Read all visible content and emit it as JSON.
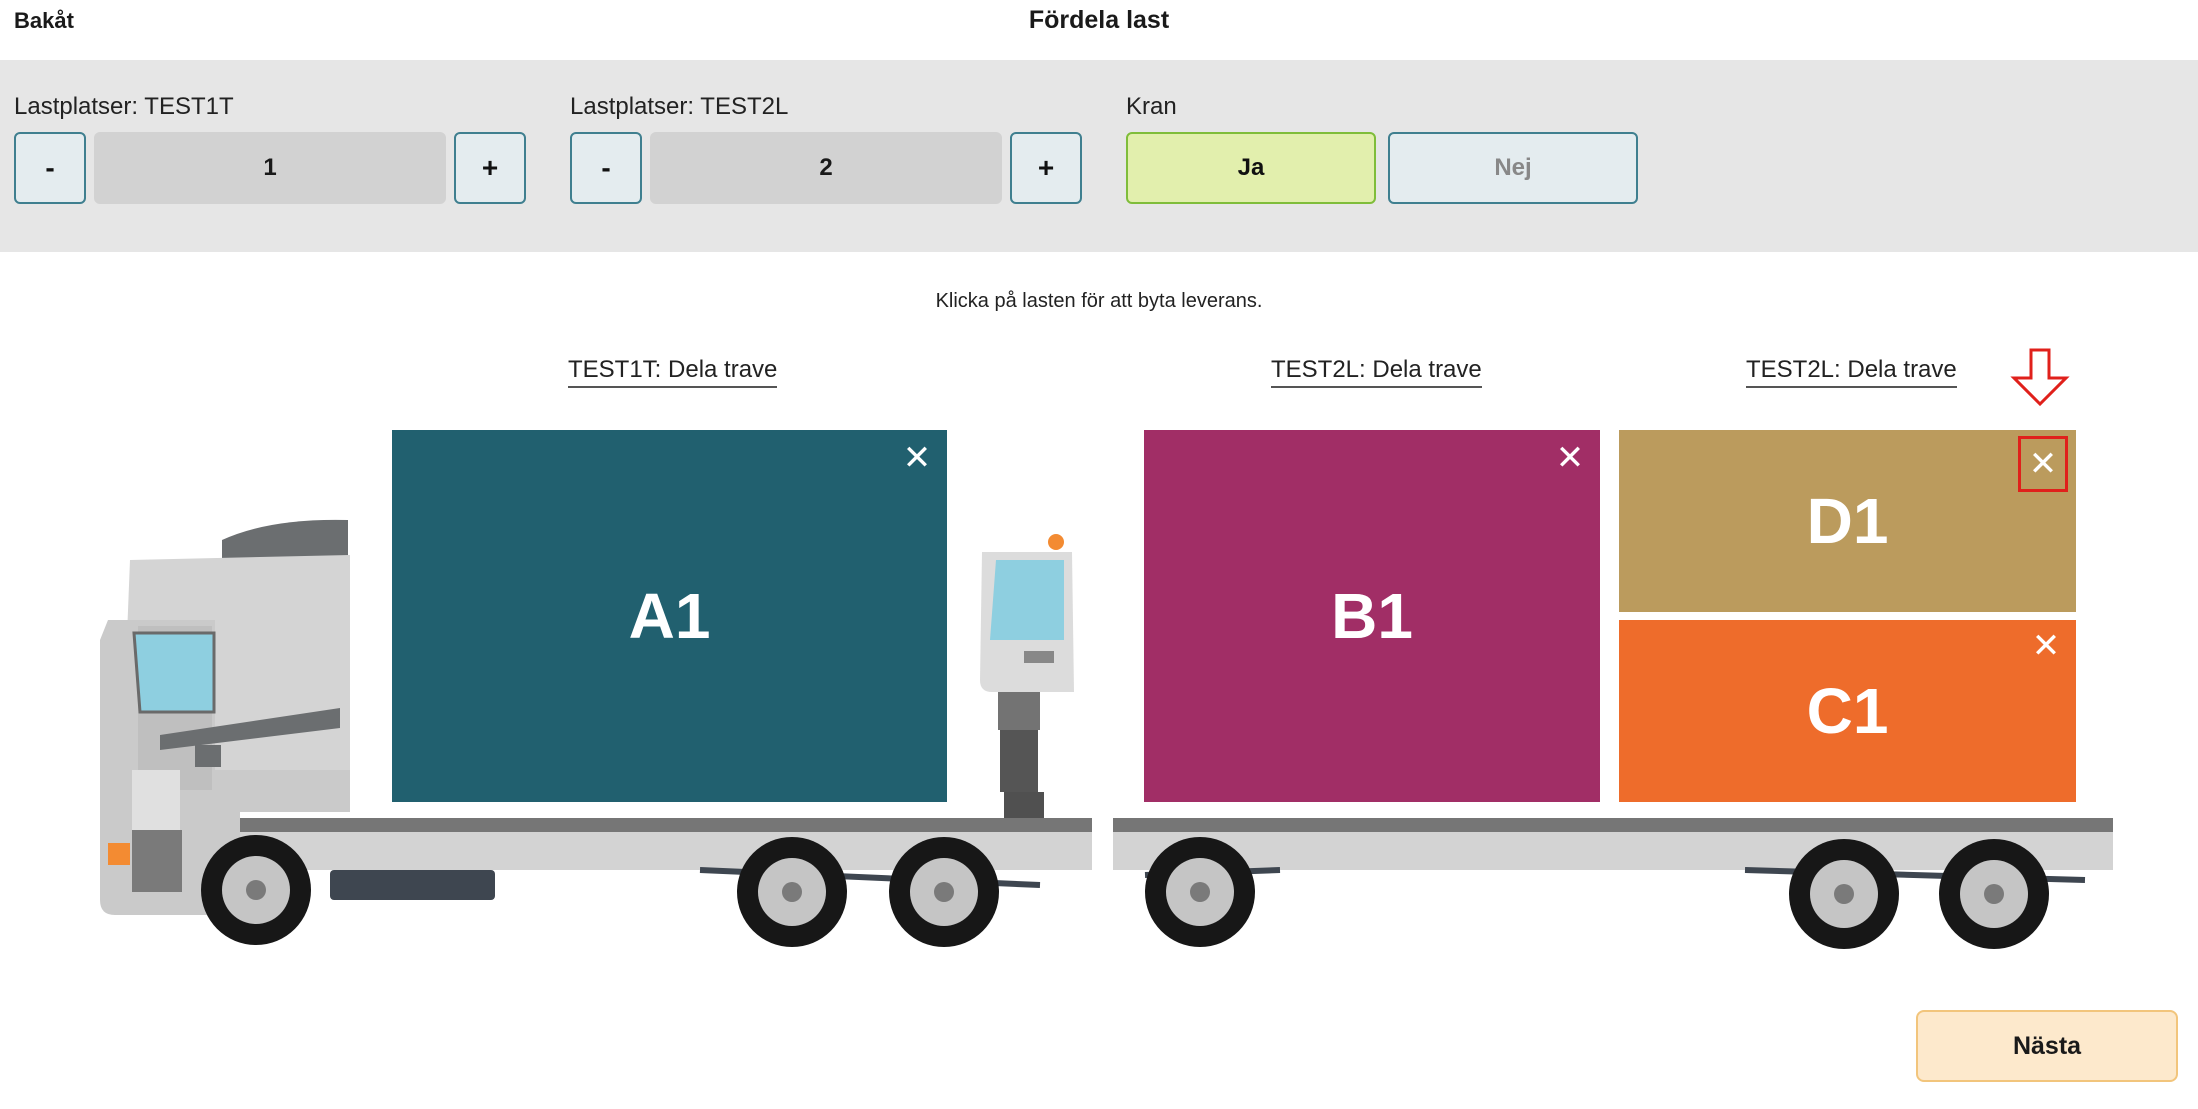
{
  "header": {
    "back_label": "Bakåt",
    "title": "Fördela last"
  },
  "controls": {
    "stop1": {
      "label": "Lastplatser: TEST1T",
      "minus": "-",
      "value": "1",
      "plus": "+"
    },
    "stop2": {
      "label": "Lastplatser: TEST2L",
      "minus": "-",
      "value": "2",
      "plus": "+"
    },
    "crane": {
      "label": "Kran",
      "yes": "Ja",
      "no": "Nej",
      "selected": "Ja"
    }
  },
  "hint": "Klicka på lasten för att byta leverans.",
  "split_links": [
    "TEST1T: Dela trave",
    "TEST2L: Dela trave",
    "TEST2L: Dela trave"
  ],
  "cargo": [
    {
      "name": "A1",
      "color": "#21606f"
    },
    {
      "name": "B1",
      "color": "#a12e66"
    },
    {
      "name": "D1",
      "color": "#bb9b5d"
    },
    {
      "name": "C1",
      "color": "#ee6c2b"
    }
  ],
  "close_glyph": "✕",
  "annotation_color": "#e0201b",
  "next_label": "Nästa"
}
